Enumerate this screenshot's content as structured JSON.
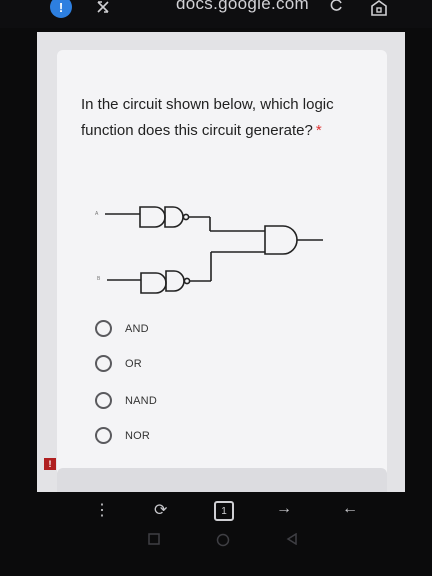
{
  "browser": {
    "url": "docs.google.com",
    "notification_count": "!",
    "tab_count": "1",
    "overflow_menu": "⋮",
    "reload_glyph": "⟳",
    "forward_glyph": "→",
    "back_glyph": "←"
  },
  "question": {
    "text": "In the circuit shown below, which logic function does this circuit generate?",
    "required_marker": "*"
  },
  "circuit": {
    "input_a_label": "A",
    "input_b_label": "B"
  },
  "options": [
    {
      "label": "AND"
    },
    {
      "label": "OR"
    },
    {
      "label": "NAND"
    },
    {
      "label": "NOR"
    }
  ],
  "warning_marker": "!"
}
